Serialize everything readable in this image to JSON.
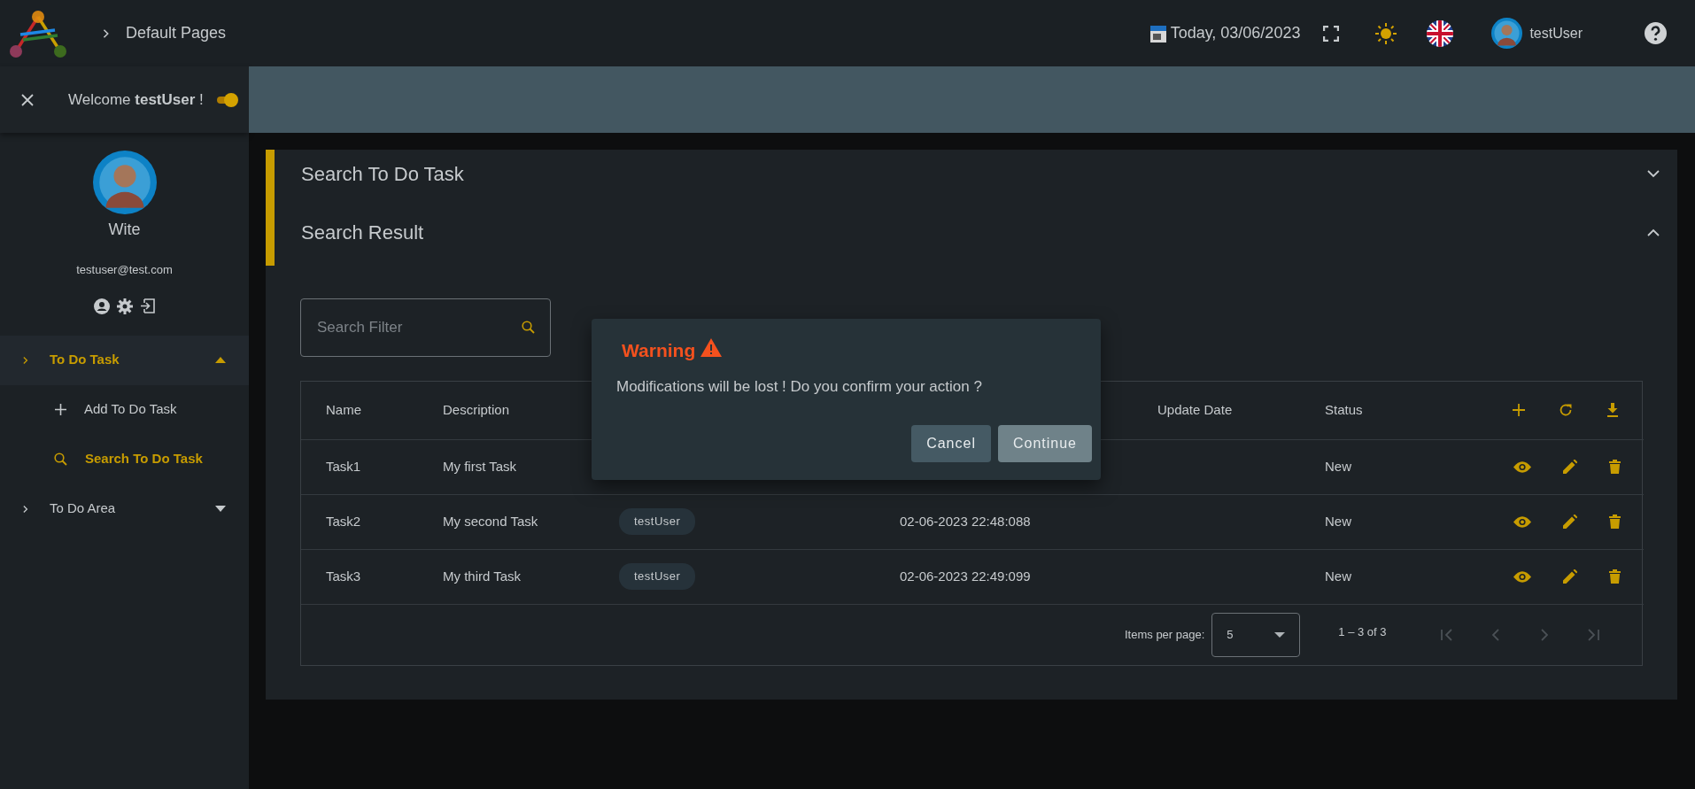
{
  "topbar": {
    "breadcrumb": "Default Pages",
    "date": "Today, 03/06/2023",
    "user": "testUser"
  },
  "sidebar": {
    "welcome": "Welcome **testUser** !",
    "toggle_on": true,
    "profile": {
      "name": "Wite",
      "email": "testuser@test.com"
    },
    "menu": [
      {
        "label": "To Do Task",
        "expanded": true,
        "selected": true,
        "children": [
          {
            "label": "Add To Do Task",
            "kind": "add",
            "selected": false
          },
          {
            "label": "Search To Do Task",
            "kind": "search",
            "selected": true
          }
        ]
      },
      {
        "label": "To Do Area",
        "expanded": false,
        "selected": false
      }
    ]
  },
  "panels": [
    {
      "title": "Search To Do Task",
      "expanded": false
    },
    {
      "title": "Search Result",
      "expanded": true
    }
  ],
  "search": {
    "placeholder": "Search Filter"
  },
  "table": {
    "columns": {
      "name": "Name",
      "description": "Description",
      "update_date": "Update Date",
      "status": "Status"
    },
    "rows": [
      {
        "name": "Task1",
        "description": "My first Task",
        "status": "New"
      },
      {
        "name": "Task2",
        "description": "My second Task",
        "column_3": "testUser",
        "column_4": "02-06-2023 22:48:088",
        "status": "New"
      },
      {
        "name": "Task3",
        "description": "My third Task",
        "column_3": "testUser",
        "column_4": "02-06-2023 22:49:099",
        "status": "New"
      }
    ]
  },
  "paginator": {
    "label": "Items per page:",
    "page_size": "5",
    "range": "1 – 3 of 3"
  },
  "dialog": {
    "title": "Warning",
    "message": "Modifications will be lost ! Do you confirm your action ?",
    "buttons": [
      {
        "label": "Cancel",
        "kind": "secondary"
      },
      {
        "label": "Continue",
        "kind": "primary"
      }
    ]
  }
}
